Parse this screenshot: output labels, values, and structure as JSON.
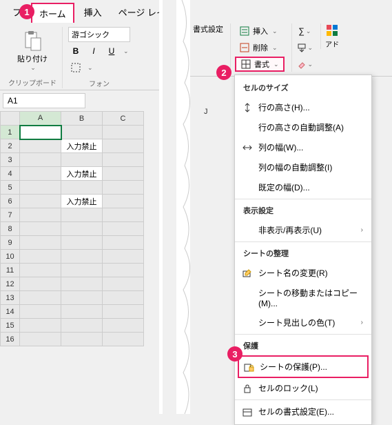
{
  "tabs": {
    "file": "フ",
    "home": "ホーム",
    "insert": "挿入",
    "layout": "ページ レイ"
  },
  "ribbon": {
    "paste": "貼り付け",
    "clipboard_label": "クリップボード",
    "font_name": "游ゴシック",
    "font_label": "フォン",
    "bold": "B",
    "italic": "I",
    "underline": "U",
    "format_setting": "書式設定",
    "insert": "挿入",
    "delete": "削除",
    "format": "書式",
    "addin": "アド"
  },
  "namebox": "A1",
  "cols": [
    "A",
    "B",
    "C"
  ],
  "col_j": "J",
  "rows": [
    "1",
    "2",
    "3",
    "4",
    "5",
    "6",
    "7",
    "8",
    "9",
    "10",
    "11",
    "12",
    "13",
    "14",
    "15",
    "16"
  ],
  "cells": {
    "b2": "入力禁止",
    "b4": "入力禁止",
    "b6": "入力禁止"
  },
  "menu": {
    "section_size": "セルのサイズ",
    "row_height": "行の高さ(H)...",
    "row_autofit": "行の高さの自動調整(A)",
    "col_width": "列の幅(W)...",
    "col_autofit": "列の幅の自動調整(I)",
    "default_width": "既定の幅(D)...",
    "section_visibility": "表示設定",
    "hide_unhide": "非表示/再表示(U)",
    "section_organize": "シートの整理",
    "rename": "シート名の変更(R)",
    "move_copy": "シートの移動またはコピー(M)...",
    "tab_color": "シート見出しの色(T)",
    "section_protect": "保護",
    "protect_sheet": "シートの保護(P)...",
    "lock_cell": "セルのロック(L)",
    "format_cells": "セルの書式設定(E)..."
  },
  "callouts": {
    "1": "1",
    "2": "2",
    "3": "3"
  }
}
